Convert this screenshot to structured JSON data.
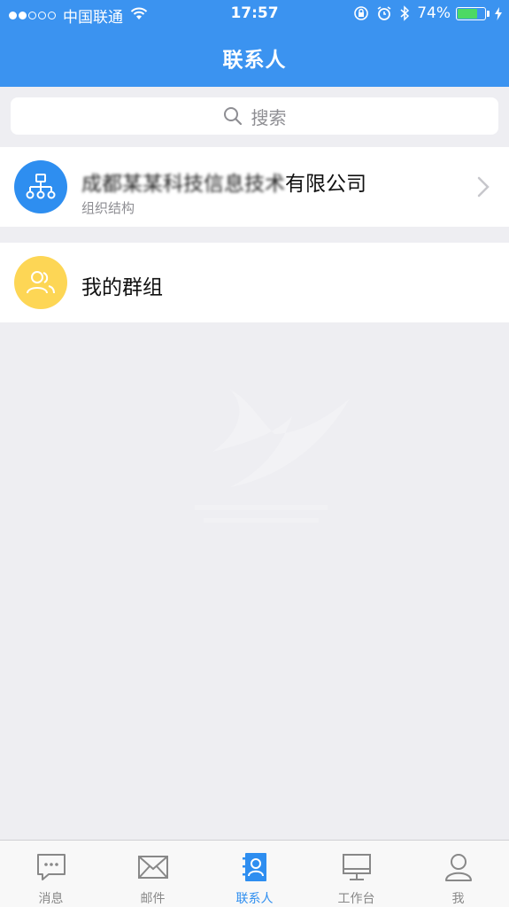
{
  "status_bar": {
    "carrier": "中国联通",
    "time": "17:57",
    "battery": "74%",
    "battery_level": 0.74
  },
  "header": {
    "title": "联系人"
  },
  "search": {
    "placeholder": "搜索"
  },
  "org": {
    "name_obscured": "成都某某科技信息技术",
    "name_suffix": "有限公司",
    "subtitle": "组织结构"
  },
  "group": {
    "name": "我的群组"
  },
  "tabbar": {
    "tabs": [
      {
        "label": "消息",
        "icon": "message-icon"
      },
      {
        "label": "邮件",
        "icon": "mail-icon"
      },
      {
        "label": "联系人",
        "icon": "contacts-icon"
      },
      {
        "label": "工作台",
        "icon": "workbench-icon"
      },
      {
        "label": "我",
        "icon": "profile-icon"
      }
    ],
    "active_tab": "联系人"
  },
  "colors": {
    "primary": "#3b93f0",
    "org_avatar": "#2e8ef0",
    "group_avatar": "#fdd655",
    "background": "#eeeef2"
  }
}
